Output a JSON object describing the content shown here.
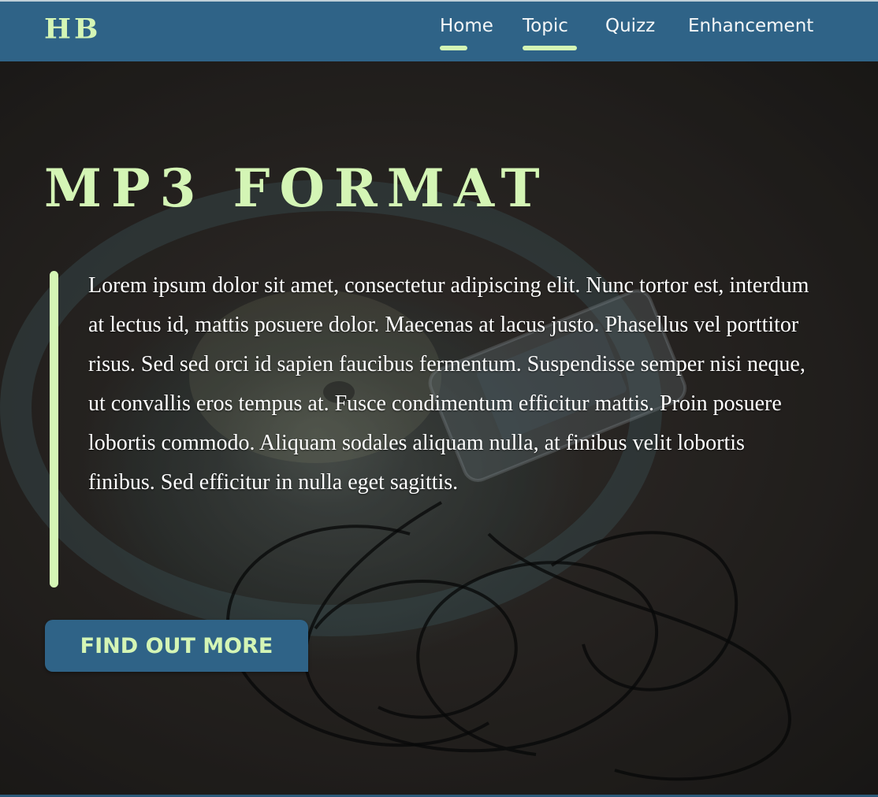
{
  "navbar": {
    "logo": "HB",
    "items": [
      {
        "label": "Home",
        "active": true
      },
      {
        "label": "Topic",
        "active": true
      },
      {
        "label": "Quizz",
        "active": false
      },
      {
        "label": "Enhancement",
        "active": false
      }
    ]
  },
  "hero": {
    "title": "MP3 FORMAT",
    "body": "Lorem ipsum dolor sit amet, consectetur adipiscing elit. Nunc tortor est, interdum at lectus id, mattis posuere dolor. Maecenas at lacus justo. Phasellus vel porttitor risus. Sed sed orci id sapien faucibus fermentum. Suspendisse semper nisi neque, ut convallis eros tempus at. Fusce condimentum efficitur mattis. Proin posuere lobortis commodo. Aliquam sodales aliquam nulla, at finibus velit lobortis finibus. Sed efficitur in nulla eget sagittis.",
    "button_label": "FIND OUT MORE"
  },
  "colors": {
    "navbar": "#2f6387",
    "accent": "#d4f5b5",
    "text": "#ffffff"
  }
}
